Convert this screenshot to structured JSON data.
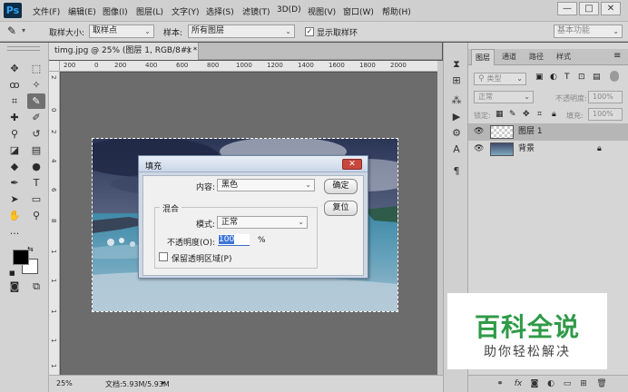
{
  "app": {
    "logo": "Ps"
  },
  "menu": [
    "文件(F)",
    "编辑(E)",
    "图像(I)",
    "图层(L)",
    "文字(Y)",
    "选择(S)",
    "滤镜(T)",
    "3D(D)",
    "视图(V)",
    "窗口(W)",
    "帮助(H)"
  ],
  "window_controls": {
    "minimize": "—",
    "maximize": "□",
    "close": "✕"
  },
  "options_bar": {
    "sample_size_label": "取样大小:",
    "sample_size_value": "取样点",
    "sample_label": "样本:",
    "sample_value": "所有图层",
    "show_ring_checked": "✓",
    "show_ring_label": "显示取样环",
    "workspace": "基本功能"
  },
  "document": {
    "tab_title": "timg.jpg @ 25% (图层 1, RGB/8#) *",
    "tab_close": "×",
    "zoom": "25%",
    "doc_info": "文档:5.93M/5.93M",
    "ruler_top_ticks": [
      "200",
      "0",
      "200",
      "400",
      "600",
      "800",
      "1000",
      "1200",
      "1400",
      "1600",
      "1800",
      "2000"
    ],
    "ruler_left_ticks": [
      "2",
      "0",
      "2",
      "4",
      "6",
      "8",
      "1",
      "1",
      "1",
      "1",
      "1"
    ]
  },
  "fill_dialog": {
    "title": "填充",
    "close": "✕",
    "content_label": "内容:",
    "content_value": "黑色",
    "blending_legend": "混合",
    "mode_label": "模式:",
    "mode_value": "正常",
    "opacity_label": "不透明度(O):",
    "opacity_value": "100",
    "opacity_unit": "%",
    "preserve_transparency_label": "保留透明区域(P)",
    "ok_label": "确定",
    "reset_label": "复位"
  },
  "layers_panel": {
    "tabs": [
      "图层",
      "通道",
      "路径",
      "样式"
    ],
    "filter_kind": "类型",
    "blend_mode": "正常",
    "opacity_label": "不透明度:",
    "opacity_value": "100%",
    "lock_label": "锁定:",
    "fill_label": "填充:",
    "fill_value": "100%",
    "layers": [
      {
        "name": "图层 1",
        "selected": true
      },
      {
        "name": "背景",
        "locked": true
      }
    ]
  },
  "watermark": {
    "title": "百科全说",
    "subtitle": "助你轻松解决"
  },
  "colors": {
    "app_bg": "#535353",
    "dialog_accent": "#3d74d8",
    "selected_layer": "#b6b6b6",
    "watermark_green": "#2f9a47"
  }
}
